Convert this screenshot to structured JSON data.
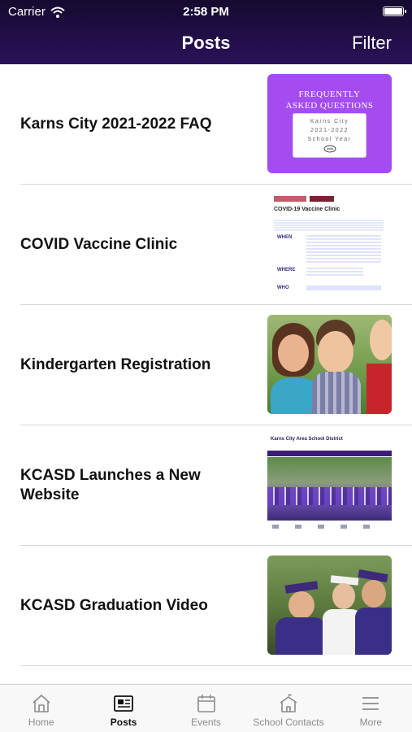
{
  "status": {
    "carrier": "Carrier",
    "time": "2:58 PM"
  },
  "nav": {
    "title": "Posts",
    "filter_label": "Filter"
  },
  "posts": [
    {
      "title": "Karns City 2021-2022 FAQ",
      "thumb_lines": [
        "FREQUENTLY",
        "ASKED QUESTIONS"
      ],
      "card_lines": [
        "Karns City",
        "2021-2022",
        "School Year"
      ]
    },
    {
      "title": "COVID Vaccine Clinic",
      "thumb_heading": "COVID-19 Vaccine Clinic",
      "thumb_labels": [
        "WHEN",
        "WHERE",
        "WHO"
      ]
    },
    {
      "title": "Kindergarten Registration"
    },
    {
      "title": "KCASD Launches a New Website",
      "thumb_heading": "Karns City Area School District"
    },
    {
      "title": "KCASD Graduation Video"
    }
  ],
  "tabs": [
    {
      "label": "Home",
      "icon": "home-icon"
    },
    {
      "label": "Posts",
      "icon": "newspaper-icon"
    },
    {
      "label": "Events",
      "icon": "calendar-icon"
    },
    {
      "label": "School Contacts",
      "icon": "school-icon"
    },
    {
      "label": "More",
      "icon": "menu-icon"
    }
  ],
  "colors": {
    "header": "#2a1259",
    "purple_card": "#a44cf0",
    "active_tab": "#111111"
  }
}
